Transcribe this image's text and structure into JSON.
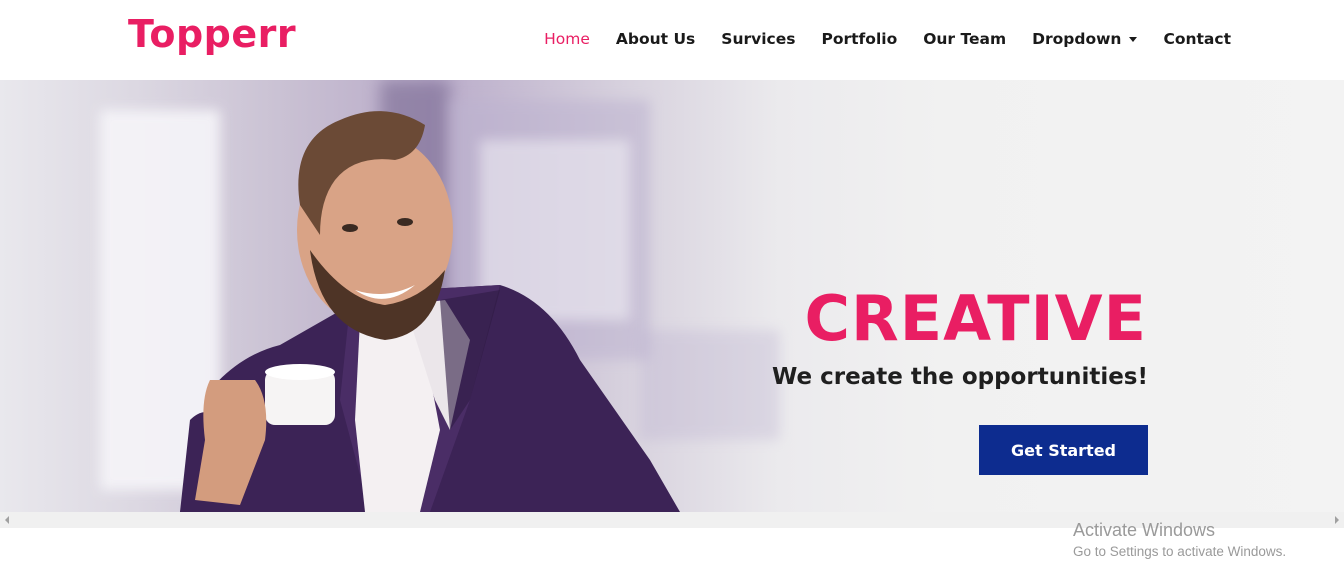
{
  "brand": {
    "name": "Topperr",
    "color": "#e91e63"
  },
  "nav": {
    "items": [
      {
        "label": "Home",
        "active": true
      },
      {
        "label": "About Us",
        "active": false
      },
      {
        "label": "Survices",
        "active": false
      },
      {
        "label": "Portfolio",
        "active": false
      },
      {
        "label": "Our Team",
        "active": false
      },
      {
        "label": "Dropdown",
        "active": false,
        "icon": "caret-down-icon"
      },
      {
        "label": "Contact",
        "active": false
      }
    ]
  },
  "hero": {
    "title": "CREATIVE",
    "subtitle": "We create the opportunities!",
    "cta_label": "Get Started",
    "cta_color": "#0d2c8f"
  },
  "watermark": {
    "title": "Activate Windows",
    "subtitle": "Go to Settings to activate Windows."
  }
}
